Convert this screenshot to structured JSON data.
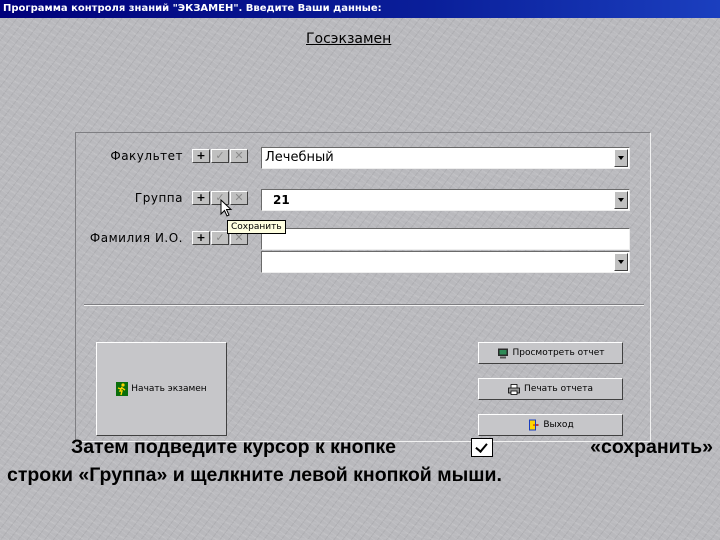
{
  "window": {
    "title": "Программа контроля знаний \"ЭКЗАМЕН\". Введите Ваши данные:"
  },
  "exam_title": "Госэкзамен",
  "form": {
    "faculty": {
      "label": "Факультет",
      "value": "Лечебный"
    },
    "group": {
      "label": "Группа",
      "value": "21"
    },
    "name": {
      "label": "Фамилия И.О.",
      "value": ""
    },
    "extra": {
      "value": ""
    },
    "mini_buttons": {
      "add": "+",
      "save": "✓",
      "delete": "✕"
    }
  },
  "tooltip": "Сохранить",
  "buttons": {
    "start": "Начать экзамен",
    "view_report": "Просмотреть отчет",
    "print_report": "Печать отчета",
    "exit": "Выход"
  },
  "caption": {
    "line1_a": "Затем подведите курсор к кнопке",
    "line1_b": "«сохранить»",
    "line2": "строки «Группа» и щелкните левой кнопкой мыши."
  },
  "colors": {
    "titlebar": "#00007b",
    "tooltip_bg": "#ffffe1",
    "button_face": "#c6c6c9"
  }
}
